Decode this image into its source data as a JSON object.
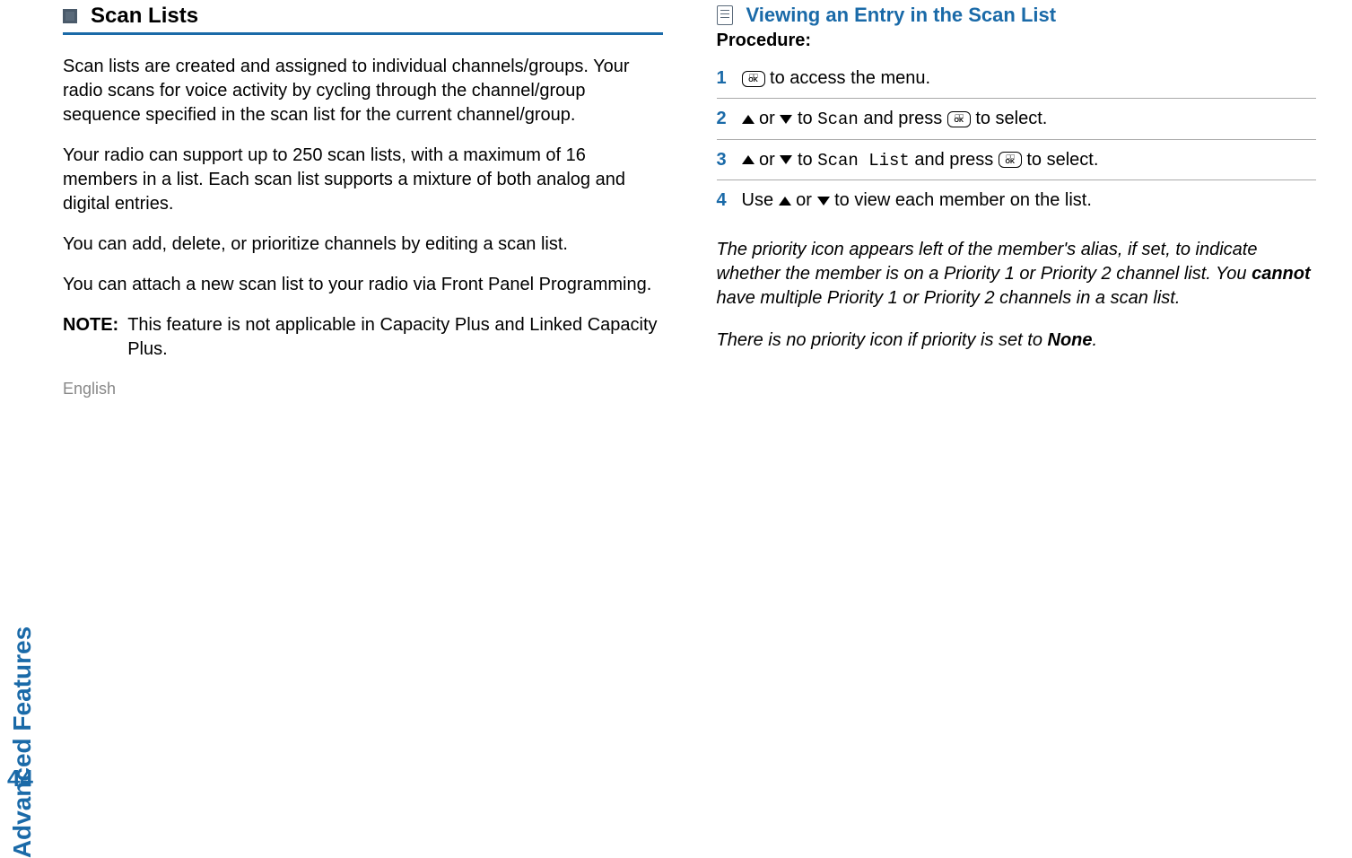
{
  "side": {
    "section": "Advanced Features",
    "language": "English",
    "page": "44"
  },
  "left": {
    "heading": "Scan Lists",
    "para1": "Scan lists are created and assigned to individual channels/groups. Your radio scans for voice activity by cycling through the channel/group sequence specified in the scan list for the current channel/group.",
    "para2": "Your radio can support up to 250 scan lists, with a maximum of 16 members in a list. Each scan list supports a mixture of both analog and digital entries.",
    "para3": "You can add, delete, or prioritize channels by editing a scan list.",
    "para4": "You can attach a new scan list to your radio via Front Panel Programming.",
    "note_label": "NOTE:",
    "note_text": "This feature is not applicable in Capacity Plus and Linked Capacity Plus."
  },
  "right": {
    "heading": "Viewing an Entry in the Scan List",
    "procedure": "Procedure:",
    "steps": {
      "s1_num": "1",
      "s1_a": " to access the menu.",
      "s2_num": "2",
      "s2_a": " or ",
      "s2_b": " to ",
      "s2_scan": "Scan",
      "s2_c": " and press ",
      "s2_d": " to select.",
      "s3_num": "3",
      "s3_a": " or ",
      "s3_b": " to ",
      "s3_scanlist": "Scan List",
      "s3_c": " and press ",
      "s3_d": " to select.",
      "s4_num": "4",
      "s4_a": "Use ",
      "s4_b": " or ",
      "s4_c": " to view each member on the list."
    },
    "note1_a": "The priority icon appears left of the member's alias, if set, to indicate whether the member is on a Priority 1 or Priority 2 channel list. You ",
    "note1_bold": "cannot",
    "note1_b": " have multiple Priority 1 or Priority 2 channels in a scan list.",
    "note2_a": "There is no priority icon if priority is set to ",
    "note2_bold": "None",
    "note2_b": "."
  }
}
